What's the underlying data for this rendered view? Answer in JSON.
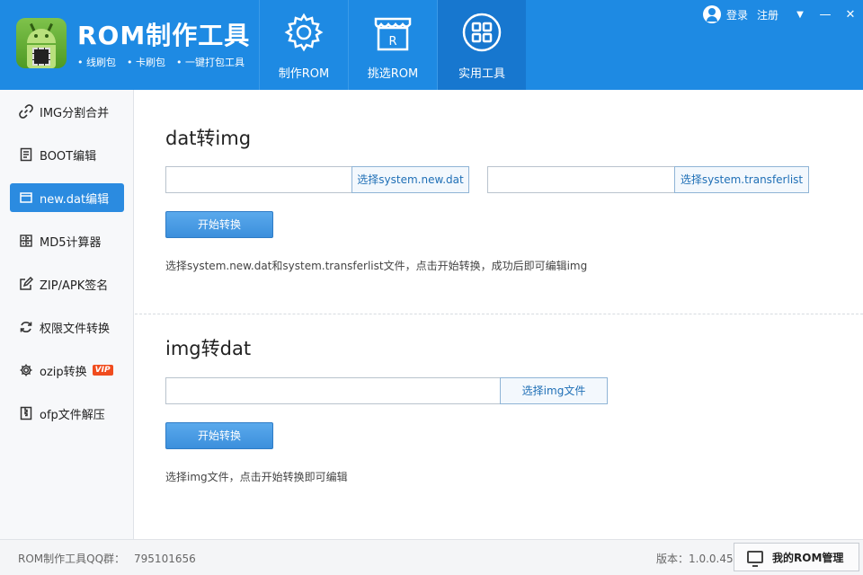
{
  "header": {
    "app_title": "ROM制作工具",
    "tags": [
      "• 线刷包",
      "• 卡刷包",
      "• 一键打包工具"
    ],
    "nav": [
      {
        "label": "制作ROM",
        "icon": "gear-icon"
      },
      {
        "label": "挑选ROM",
        "icon": "store-icon"
      },
      {
        "label": "实用工具",
        "icon": "grid-icon"
      }
    ],
    "login": "登录",
    "register": "注册",
    "dropdown": "▼",
    "minimize": "—",
    "close": "✕"
  },
  "sidebar": {
    "items": [
      {
        "label": "IMG分割合并",
        "icon": "link-icon",
        "glyph": "🔗"
      },
      {
        "label": "BOOT编辑",
        "icon": "document-icon",
        "glyph": "📄"
      },
      {
        "label": "new.dat编辑",
        "icon": "file-icon",
        "glyph": "▭"
      },
      {
        "label": "MD5计算器",
        "icon": "calculator-icon",
        "glyph": "▦"
      },
      {
        "label": "ZIP/APK签名",
        "icon": "edit-icon",
        "glyph": "✎"
      },
      {
        "label": "权限文件转换",
        "icon": "refresh-icon",
        "glyph": "⟳"
      },
      {
        "label": "ozip转换",
        "icon": "gear-icon",
        "glyph": "⚙",
        "badge": "VIP"
      },
      {
        "label": "ofp文件解压",
        "icon": "archive-icon",
        "glyph": "⧉"
      }
    ]
  },
  "dat2img": {
    "title": "dat转img",
    "input1_value": "",
    "pick1_label": "选择system.new.dat",
    "input2_value": "",
    "pick2_label": "选择system.transferlist",
    "start_label": "开始转换",
    "hint": "选择system.new.dat和system.transferlist文件，点击开始转换，成功后即可编辑img"
  },
  "img2dat": {
    "title": "img转dat",
    "input_value": "",
    "pick_label": "选择img文件",
    "start_label": "开始转换",
    "hint": "选择img文件，点击开始转换即可编辑"
  },
  "footer": {
    "qq_label": "ROM制作工具QQ群：",
    "qq_number": "795101656",
    "version": "版本：1.0.0.45",
    "rom_manager": "我的ROM管理"
  }
}
